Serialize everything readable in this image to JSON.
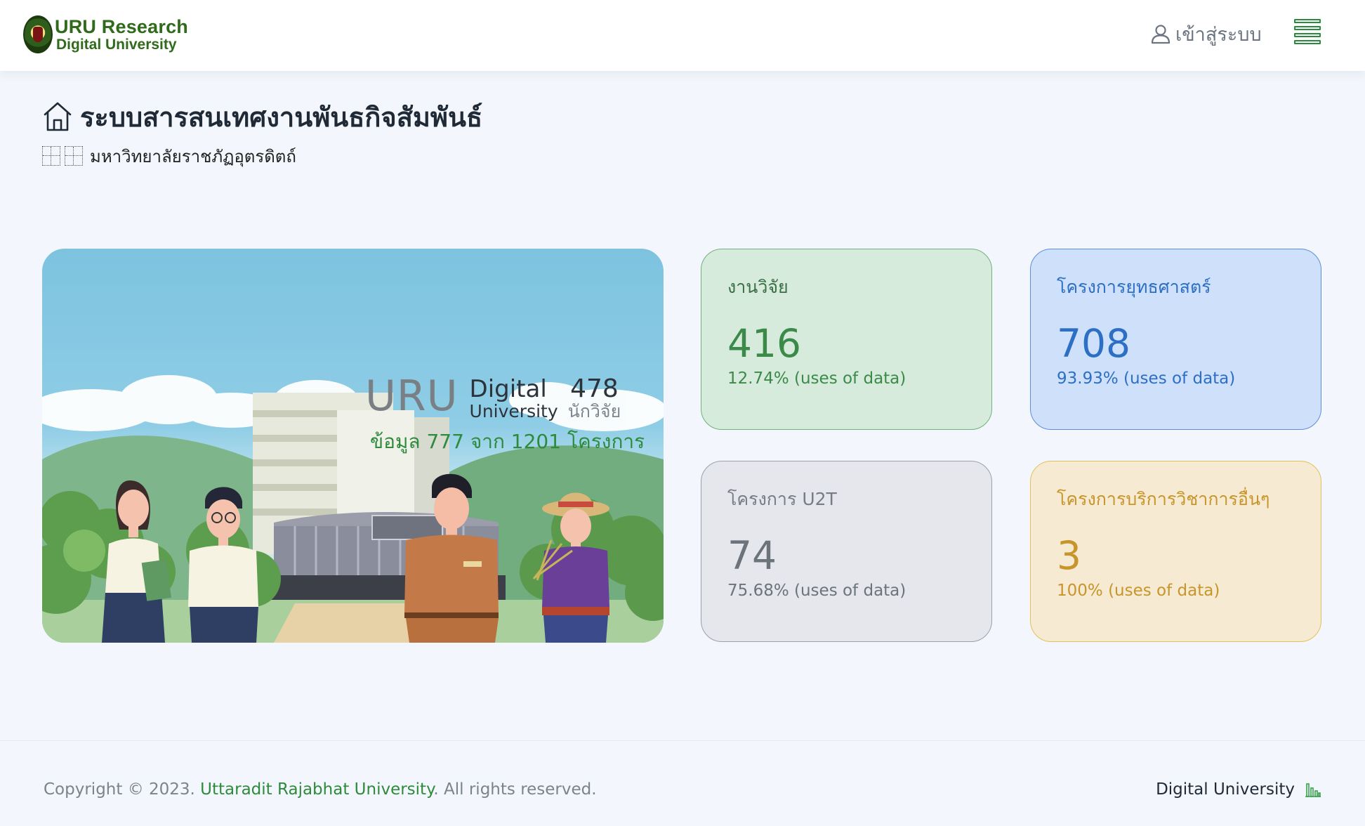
{
  "header": {
    "logo_line1": "URU Research",
    "logo_line2": "Digital University",
    "login_label": "เข้าสู่ระบบ"
  },
  "page": {
    "title": "ระบบสารสนเทศงานพันธกิจสัมพันธ์",
    "subtitle": "มหาวิทยาลัยราชภัฏอุตรดิตถ์"
  },
  "hero": {
    "brand_uru": "URU",
    "brand_digital": "Digital",
    "brand_university": "University",
    "researcher_count": "478",
    "researcher_unit": "นักวิจัย",
    "caption": "ข้อมูล 777 จาก 1201 โครงการ"
  },
  "cards": [
    {
      "label": "งานวิจัย",
      "value": "416",
      "percent": "12.74% (uses of data)",
      "color": "#3b8a49"
    },
    {
      "label": "โครงการยุทธศาสตร์",
      "value": "708",
      "percent": "93.93% (uses of data)",
      "color": "#2c6fc4"
    },
    {
      "label": "โครงการ U2T",
      "value": "74",
      "percent": "75.68% (uses of data)",
      "color": "#6c737b"
    },
    {
      "label": "โครงการบริการวิชาการอื่นๆ",
      "value": "3",
      "percent": "100% (uses of data)",
      "color": "#c8952a"
    }
  ],
  "footer": {
    "copyright_prefix": "Copyright © 2023. ",
    "copyright_link": "Uttaradit Rajabhat University",
    "copyright_suffix": ". All rights reserved.",
    "brand": "Digital University"
  },
  "icons": {
    "user": "user-icon",
    "menu": "hamburger-menu-icon",
    "home": "home-icon",
    "chart": "bar-chart-icon"
  }
}
